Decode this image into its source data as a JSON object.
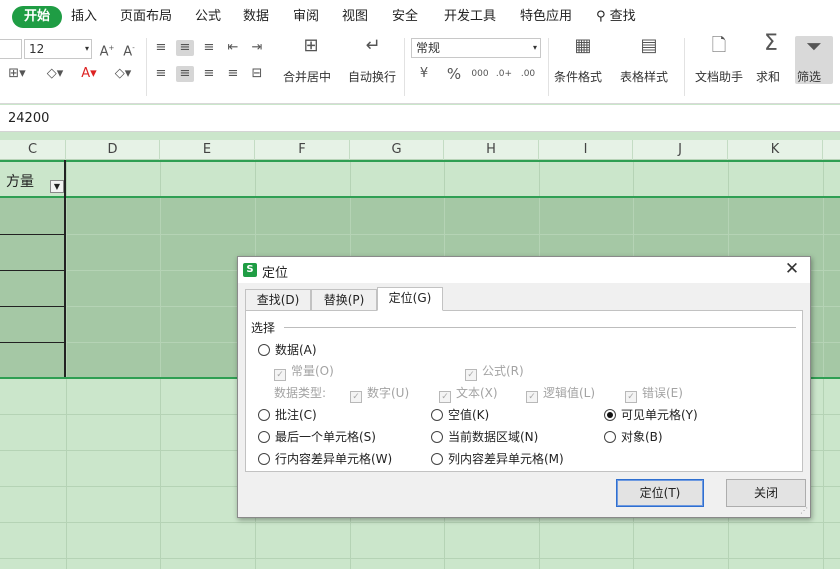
{
  "menubar": {
    "tabs": [
      "开始",
      "插入",
      "页面布局",
      "公式",
      "数据",
      "审阅",
      "视图",
      "安全",
      "开发工具",
      "特色应用",
      "查找"
    ]
  },
  "ribbon": {
    "font_size": "12",
    "merge_center": "合并居中",
    "wrap_text": "自动换行",
    "number_format": "常规",
    "conditional_format": "条件格式",
    "table_style": "表格样式",
    "doc_helper": "文档助手",
    "sum": "求和",
    "filter": "筛选"
  },
  "formula_bar": {
    "value": "24200"
  },
  "columns": [
    "C",
    "D",
    "E",
    "F",
    "G",
    "H",
    "I",
    "J",
    "K"
  ],
  "cells": {
    "c1": "方量"
  },
  "dialog": {
    "title": "定位",
    "tabs": [
      "查找(D)",
      "替换(P)",
      "定位(G)"
    ],
    "group_label": "选择",
    "opt_data": "数据(A)",
    "chk_const": "常量(O)",
    "chk_formula": "公式(R)",
    "data_type_label": "数据类型:",
    "chk_number": "数字(U)",
    "chk_text": "文本(X)",
    "chk_logic": "逻辑值(L)",
    "chk_error": "错误(E)",
    "opt_comment": "批注(C)",
    "opt_blank": "空值(K)",
    "opt_visible": "可见单元格(Y)",
    "opt_last": "最后一个单元格(S)",
    "opt_region": "当前数据区域(N)",
    "opt_object": "对象(B)",
    "opt_rowdiff": "行内容差异单元格(W)",
    "opt_coldiff": "列内容差异单元格(M)",
    "btn_goto": "定位(T)",
    "btn_close": "关闭"
  },
  "colors": {
    "accent": "#1f9d44",
    "sheet_bg": "#cbe6cb",
    "highlight": "#e02020"
  }
}
